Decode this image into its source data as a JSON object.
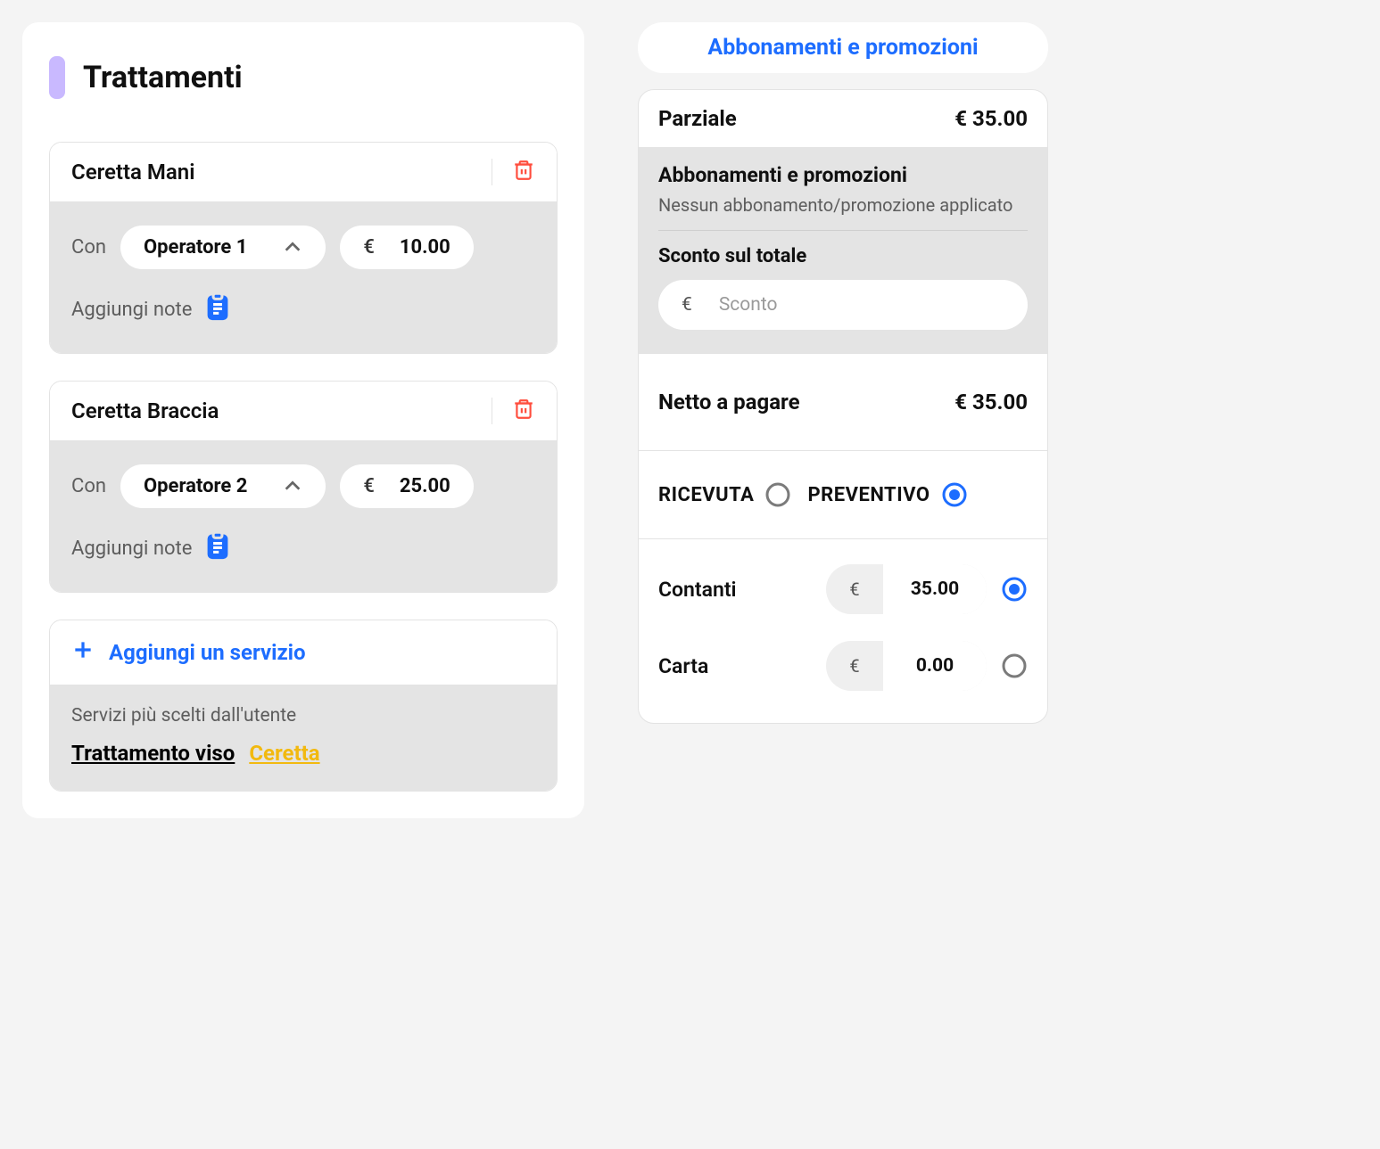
{
  "currency": "€",
  "left": {
    "title": "Trattamenti",
    "con_label": "Con",
    "notes_label": "Aggiungi note",
    "add_service_label": "Aggiungi un servizio",
    "suggest_label": "Servizi più scelti dall'utente",
    "suggest_1": "Trattamento viso",
    "suggest_2": "Ceretta",
    "services": [
      {
        "name": "Ceretta Mani",
        "operator": "Operatore 1",
        "price": "10.00"
      },
      {
        "name": "Ceretta Braccia",
        "operator": "Operatore 2",
        "price": "25.00"
      }
    ]
  },
  "right": {
    "promo_btn": "Abbonamenti e promozioni",
    "partial_label": "Parziale",
    "partial_value": "€ 35.00",
    "promo_box_title": "Abbonamenti e promozioni",
    "promo_none": "Nessun abbonamento/promozione applicato",
    "discount_label": "Sconto sul totale",
    "discount_placeholder": "Sconto",
    "net_label": "Netto a pagare",
    "net_value": "€ 35.00",
    "doc_ricevuta": "RICEVUTA",
    "doc_preventivo": "PREVENTIVO",
    "doc_selected": "preventivo",
    "pay_cash_label": "Contanti",
    "pay_cash_value": "35.00",
    "pay_card_label": "Carta",
    "pay_card_value": "0.00",
    "pay_selected": "contanti"
  }
}
